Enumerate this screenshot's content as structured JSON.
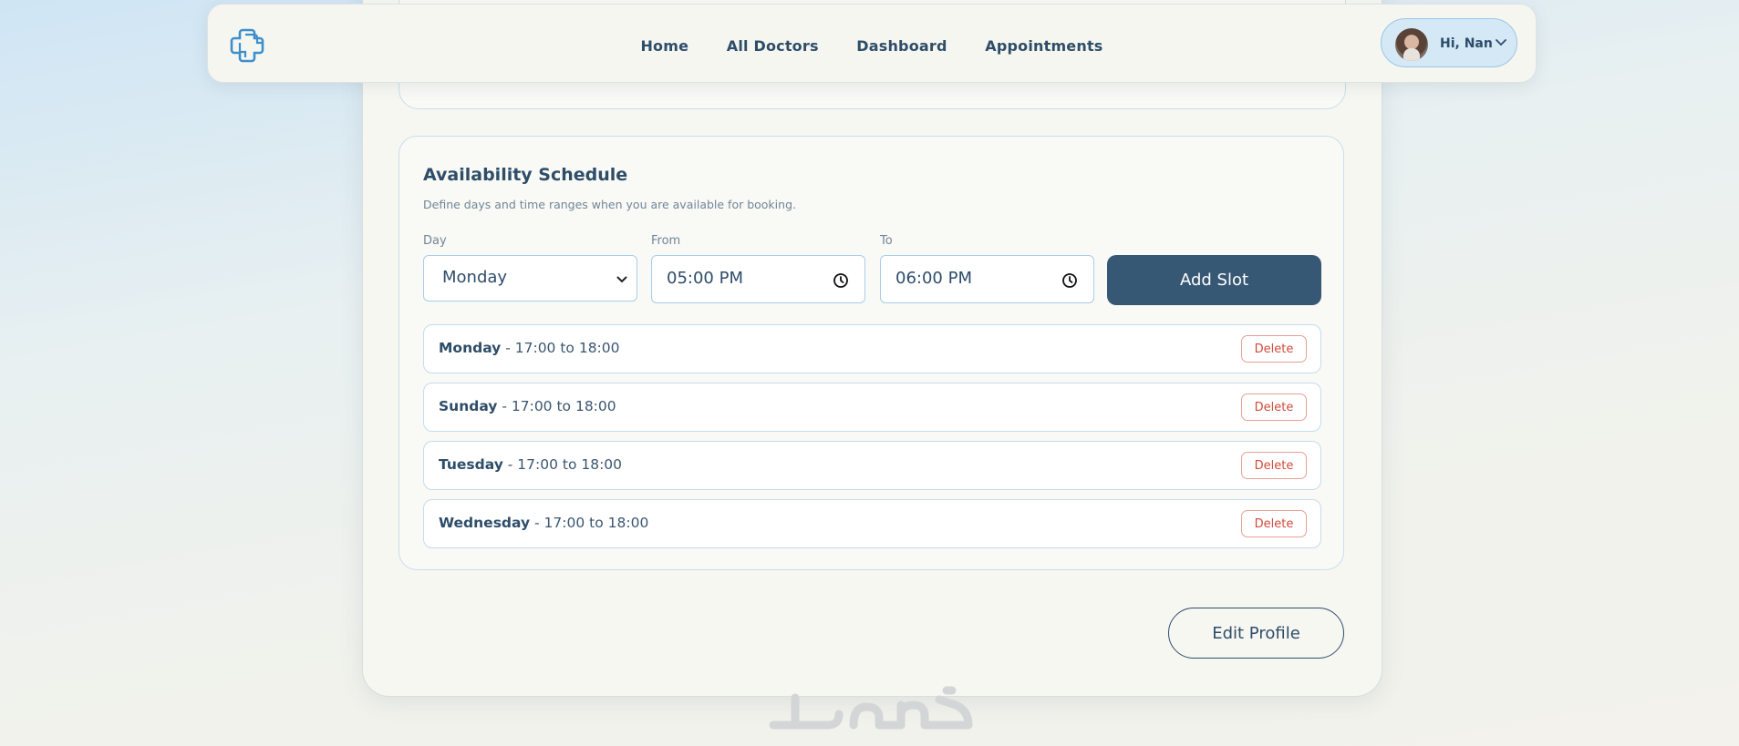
{
  "nav": {
    "links": [
      "Home",
      "All Doctors",
      "Dashboard",
      "Appointments"
    ],
    "greeting": "Hi, Nan"
  },
  "schedule": {
    "title": "Availability Schedule",
    "description": "Define days and time ranges when you are available for booking.",
    "day_label": "Day",
    "day_value": "Monday",
    "from_label": "From",
    "from_value": "05:00 PM",
    "to_label": "To",
    "to_value": "06:00 PM",
    "add_button": "Add Slot",
    "slots": [
      {
        "day": "Monday",
        "range": " - 17:00 to 18:00",
        "action": "Delete"
      },
      {
        "day": "Sunday",
        "range": " - 17:00 to 18:00",
        "action": "Delete"
      },
      {
        "day": "Tuesday",
        "range": " - 17:00 to 18:00",
        "action": "Delete"
      },
      {
        "day": "Wednesday",
        "range": " - 17:00 to 18:00",
        "action": "Delete"
      }
    ]
  },
  "edit_profile_label": "Edit Profile",
  "watermark_text": "خمسات",
  "colors": {
    "primary": "#375874",
    "text": "#2e4d69",
    "danger": "#d04a3a",
    "border": "#c9def0",
    "pill_bg": "#d4e8f6"
  },
  "icons": {
    "logo": "medical-cross-logo-icon",
    "chevron": "chevron-down-icon",
    "clock": "clock-icon",
    "select": "chevron-down-icon"
  }
}
